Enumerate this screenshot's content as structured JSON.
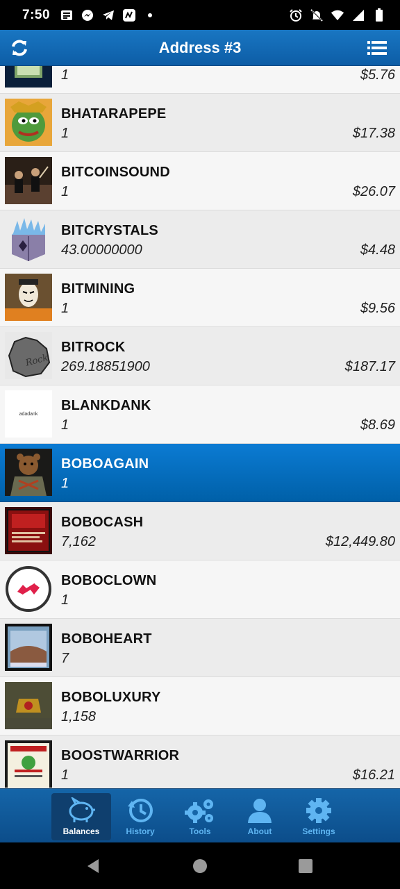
{
  "status_bar": {
    "time": "7:50"
  },
  "app_bar": {
    "title": "Address #3"
  },
  "assets": [
    {
      "name": "",
      "qty": "1",
      "value": "$5.76",
      "thumb": "framed-card-thumb"
    },
    {
      "name": "BHATARAPEPE",
      "qty": "1",
      "value": "$17.38",
      "thumb": "pepe-thumb"
    },
    {
      "name": "BITCOINSOUND",
      "qty": "1",
      "value": "$26.07",
      "thumb": "orchestra-thumb"
    },
    {
      "name": "BITCRYSTALS",
      "qty": "43.00000000",
      "value": "$4.48",
      "thumb": "crystal-box-thumb"
    },
    {
      "name": "BITMINING",
      "qty": "1",
      "value": "$9.56",
      "thumb": "mask-miner-thumb"
    },
    {
      "name": "BITROCK",
      "qty": "269.18851900",
      "value": "$187.17",
      "thumb": "rock-thumb"
    },
    {
      "name": "BLANKDANK",
      "qty": "1",
      "value": "$8.69",
      "thumb": "blankdank-thumb"
    },
    {
      "name": "BOBOAGAIN",
      "qty": "1",
      "value": "",
      "thumb": "bear-thumb"
    },
    {
      "name": "BOBOCASH",
      "qty": "7,162",
      "value": "$12,449.80",
      "thumb": "red-card-thumb"
    },
    {
      "name": "BOBOCLOWN",
      "qty": "1",
      "value": "",
      "thumb": "clown-logo-thumb"
    },
    {
      "name": "BOBOHEART",
      "qty": "7",
      "value": "",
      "thumb": "blue-card-thumb"
    },
    {
      "name": "BOBOLUXURY",
      "qty": "1,158",
      "value": "",
      "thumb": "luxury-thumb"
    },
    {
      "name": "BOOSTWARRIOR",
      "qty": "1",
      "value": "$16.21",
      "thumb": "warrior-card-thumb"
    }
  ],
  "blankdank_thumb_text": "adadank",
  "selected_index": 7,
  "bottom_nav": [
    {
      "label": "Balances",
      "icon": "piggy-bank-icon",
      "active": true
    },
    {
      "label": "History",
      "icon": "history-icon",
      "active": false
    },
    {
      "label": "Tools",
      "icon": "gears-icon",
      "active": false
    },
    {
      "label": "About",
      "icon": "user-icon",
      "active": false
    },
    {
      "label": "Settings",
      "icon": "gear-icon",
      "active": false
    }
  ],
  "colors": {
    "app_bar": "#1976c2",
    "selected_row": "#0b7bd3",
    "nav_bg": "#1565a8",
    "nav_icon": "#5fb5f2"
  }
}
